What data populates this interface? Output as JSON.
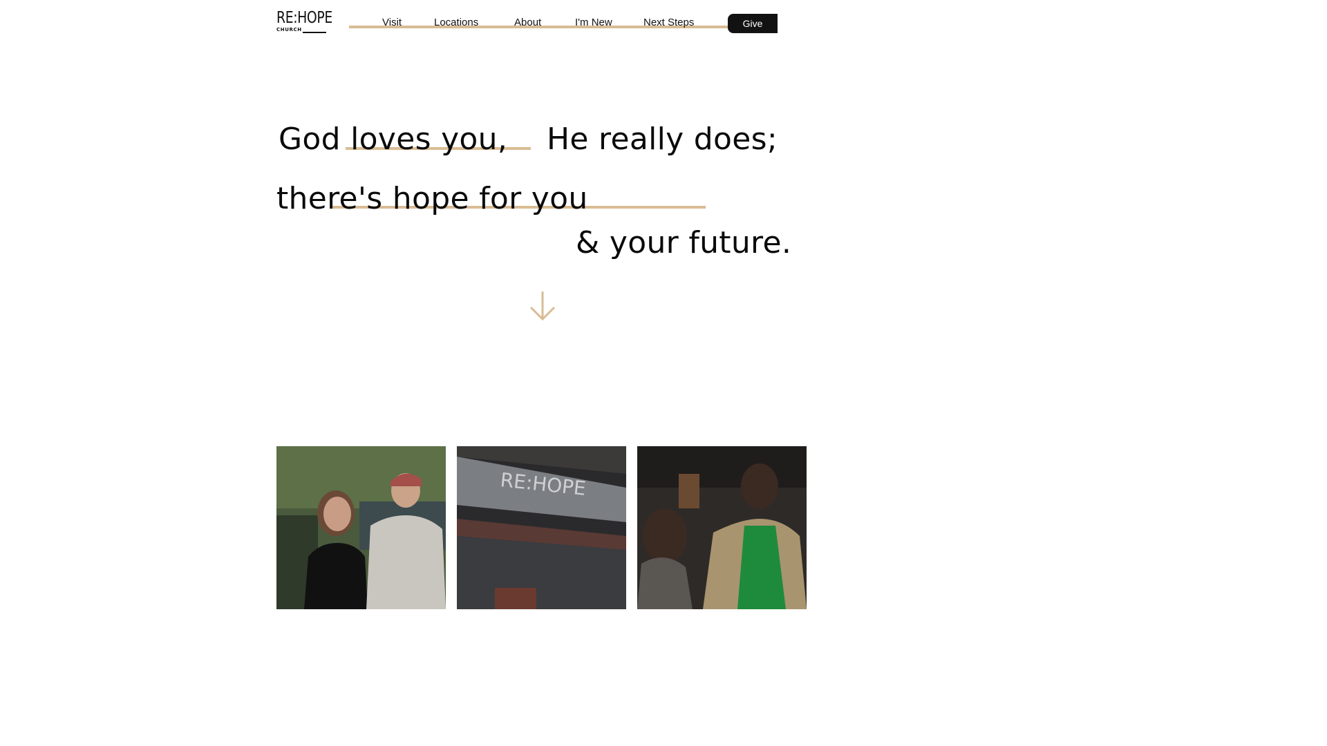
{
  "header": {
    "logo": {
      "main": "RE:HOPE",
      "sub": "CHURCH"
    },
    "nav": [
      {
        "label": "Visit"
      },
      {
        "label": "Locations"
      },
      {
        "label": "About"
      },
      {
        "label": "I'm New"
      },
      {
        "label": "Next Steps"
      }
    ],
    "give_label": "Give"
  },
  "hero": {
    "line1a": "God loves you,",
    "line1b": "He really does;",
    "line2": "there's hope for you",
    "line3": "& your future."
  },
  "icons": {
    "scroll": "arrow-down-icon"
  },
  "colors": {
    "accent": "#d9bc94",
    "button_bg": "#121212",
    "text": "#0a0a0a"
  },
  "photos": [
    {
      "name": "people-photo"
    },
    {
      "name": "church-sign-photo"
    },
    {
      "name": "congregation-photo"
    }
  ]
}
